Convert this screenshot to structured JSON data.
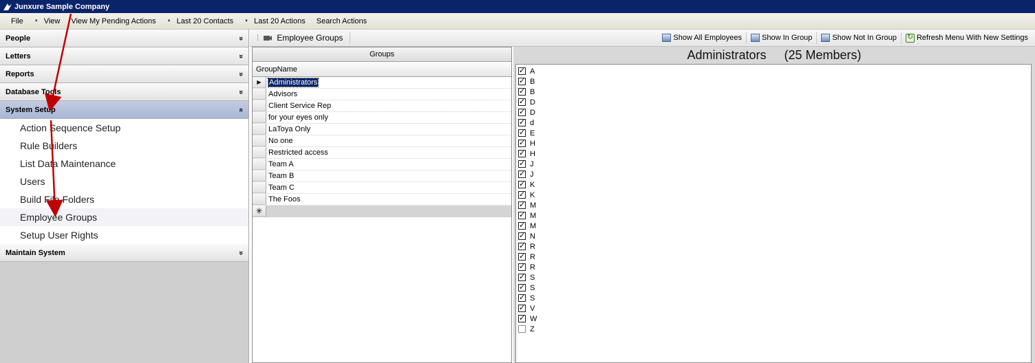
{
  "window": {
    "title": "Junxure Sample Company",
    "icon": "app-logo-icon"
  },
  "menu": {
    "items": [
      {
        "label": "File",
        "dropdown": false
      },
      {
        "label": "View",
        "dropdown": true
      },
      {
        "label": "View My Pending Actions",
        "dropdown": false
      },
      {
        "label": "Last 20 Contacts",
        "dropdown": true
      },
      {
        "label": "Last 20 Actions",
        "dropdown": true
      },
      {
        "label": "Search Actions",
        "dropdown": false
      }
    ]
  },
  "sidebar": {
    "sections_top": [
      {
        "label": "People",
        "chevron": "»"
      },
      {
        "label": "Letters",
        "chevron": "»"
      },
      {
        "label": "Reports",
        "chevron": "»"
      },
      {
        "label": "Database Tools",
        "chevron": "»"
      }
    ],
    "active_section": {
      "label": "System Setup",
      "chevron": "«"
    },
    "items": [
      "Action Sequence Setup",
      "Rule Builders",
      "List Data Maintenance",
      "Users",
      "Build File Folders",
      "Employee Groups",
      "Setup User Rights"
    ],
    "selected_item": "Employee Groups",
    "sections_bottom": [
      {
        "label": "Maintain System",
        "chevron": "»"
      }
    ]
  },
  "toolbar": {
    "title": "Employee Groups",
    "buttons": [
      {
        "label": "Show All Employees",
        "icon": "image-icon"
      },
      {
        "label": "Show In Group",
        "icon": "image-icon"
      },
      {
        "label": "Show Not In Group",
        "icon": "image-icon"
      },
      {
        "label": "Refresh Menu With New Settings",
        "icon": "refresh-icon"
      }
    ]
  },
  "groups_grid": {
    "caption": "Groups",
    "column": "GroupName",
    "rows": [
      "Administrators",
      "Advisors",
      "Client Service Rep",
      "for your eyes only",
      "LaToya Only",
      "No one",
      "Restricted access",
      "Team A",
      "Team B",
      "Team C",
      "The Foos"
    ],
    "selected_row": "Administrators",
    "new_row_marker": "✳"
  },
  "members_panel": {
    "group_name": "Administrators",
    "member_count": "(25 Members)",
    "members": [
      {
        "label": "A",
        "checked": true
      },
      {
        "label": "B",
        "checked": true
      },
      {
        "label": "B",
        "checked": true
      },
      {
        "label": "D",
        "checked": true
      },
      {
        "label": "D",
        "checked": true
      },
      {
        "label": "d",
        "checked": true
      },
      {
        "label": "E",
        "checked": true
      },
      {
        "label": "H",
        "checked": true
      },
      {
        "label": "H",
        "checked": true
      },
      {
        "label": "J",
        "checked": true
      },
      {
        "label": "J",
        "checked": true
      },
      {
        "label": "K",
        "checked": true
      },
      {
        "label": "K",
        "checked": true
      },
      {
        "label": "M",
        "checked": true
      },
      {
        "label": "M",
        "checked": true
      },
      {
        "label": "M",
        "checked": true
      },
      {
        "label": "N",
        "checked": true
      },
      {
        "label": "R",
        "checked": true
      },
      {
        "label": "R",
        "checked": true
      },
      {
        "label": "R",
        "checked": true
      },
      {
        "label": "S",
        "checked": true
      },
      {
        "label": "S",
        "checked": true
      },
      {
        "label": "S",
        "checked": true
      },
      {
        "label": "V",
        "checked": true
      },
      {
        "label": "W",
        "checked": true
      },
      {
        "label": "Z",
        "checked": false
      }
    ]
  },
  "colors": {
    "titlebar": "#0a246a",
    "annotation_arrow": "#c00000",
    "active_section": "#a9b6d6"
  }
}
